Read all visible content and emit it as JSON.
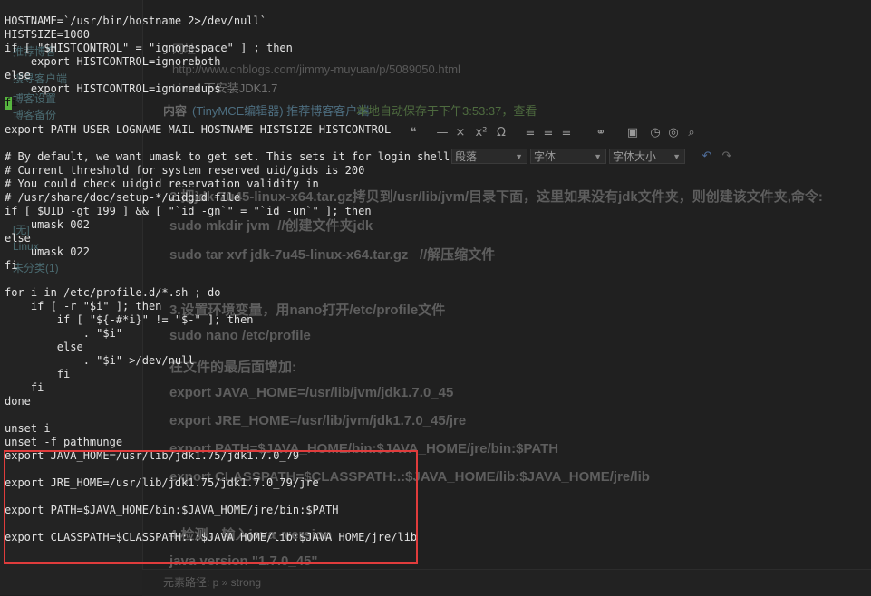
{
  "background_page": {
    "sidebar_items": [
      "推荐博客",
      "搜寻客户端",
      "博客设置",
      "博客备份",
      "[无]",
      "Linux",
      "未分类(1)"
    ],
    "source_label": "网址",
    "url": "http://www.cnblogs.com/jimmy-muyuan/p/5089050.html",
    "post_title_fragment": "Linux 下安装JDK1.7",
    "content_label": "内容",
    "editor_info": "(TinyMCE编辑器) 推荐博客客户端",
    "autosave": "本地自动保存于下午3:53:37，查看",
    "toolbar_selects": [
      "段落",
      "字体",
      "字体大小"
    ],
    "doc_lines": [
      "2.把jdk-7u45-linux-x64.tar.gz拷贝到/usr/lib/jvm/目录下面，这里如果没有jdk文件夹，则创建该文件夹,命令:",
      "sudo mkdir jvm  //创建文件夹jdk",
      "sudo tar xvf jdk-7u45-linux-x64.tar.gz   //解压缩文件",
      "3.设置环境变量，用nano打开/etc/profile文件",
      "sudo nano /etc/profile",
      "在文件的最后面增加:",
      "export JAVA_HOME=/usr/lib/jvm/jdk1.7.0_45",
      "export JRE_HOME=/usr/lib/jvm/jdk1.7.0_45/jre",
      "export PATH=$JAVA_HOME/bin:$JAVA_HOME/jre/bin:$PATH",
      "export CLASSPATH=$CLASSPATH:.:$JAVA_HOME/lib:$JAVA_HOME/jre/lib",
      "4.检测，输入java -version",
      "java version \"1.7.0_45\""
    ],
    "status_path": "元素路径: p » strong"
  },
  "terminal": {
    "lines": [
      "HOSTNAME=`/usr/bin/hostname 2>/dev/null`",
      "HISTSIZE=1000",
      "if [ \"$HISTCONTROL\" = \"ignorespace\" ] ; then",
      "    export HISTCONTROL=ignoreboth",
      "else",
      "    export HISTCONTROL=ignoredups",
      "fi",
      "",
      "export PATH USER LOGNAME MAIL HOSTNAME HISTSIZE HISTCONTROL",
      "",
      "# By default, we want umask to get set. This sets it for login shell",
      "# Current threshold for system reserved uid/gids is 200",
      "# You could check uidgid reservation validity in",
      "# /usr/share/doc/setup-*/uidgid file",
      "if [ $UID -gt 199 ] && [ \"`id -gn`\" = \"`id -un`\" ]; then",
      "    umask 002",
      "else",
      "    umask 022",
      "fi",
      "",
      "for i in /etc/profile.d/*.sh ; do",
      "    if [ -r \"$i\" ]; then",
      "        if [ \"${-#*i}\" != \"$-\" ]; then",
      "            . \"$i\"",
      "        else",
      "            . \"$i\" >/dev/null",
      "        fi",
      "    fi",
      "done",
      "",
      "unset i",
      "unset -f pathmunge"
    ],
    "highlighted_lines": [
      "export JAVA_HOME=/usr/lib/jdk1.75/jdk1.7.0_79",
      "",
      "export JRE_HOME=/usr/lib/jdk1.75/jdk1.7.0_79/jre",
      "",
      "export PATH=$JAVA_HOME/bin:$JAVA_HOME/jre/bin:$PATH",
      "",
      "export CLASSPATH=$CLASSPATH:.:$JAVA_HOME/lib:$JAVA_HOME/jre/lib"
    ],
    "highlight_color": "#e03c3c",
    "cursor_color": "#57b63f"
  }
}
